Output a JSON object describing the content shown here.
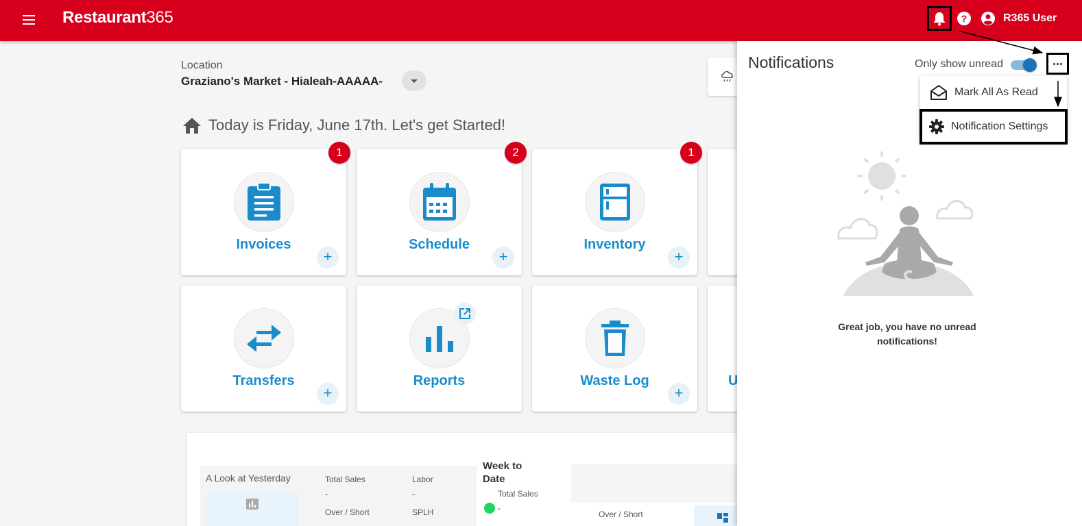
{
  "header": {
    "brand_text": "Restaurant",
    "brand_num": "365",
    "user_name": "R365 User",
    "brand_color": "#d6001c"
  },
  "location": {
    "label": "Location",
    "value": "Graziano's Market - Hialeah-AAAAA-"
  },
  "greeting": "Today is Friday, June 17th. Let's get Started!",
  "tiles": [
    {
      "name": "Invoices",
      "badge": "1",
      "plus": "+"
    },
    {
      "name": "Schedule",
      "badge": "2",
      "plus": "+"
    },
    {
      "name": "Inventory",
      "badge": "1",
      "plus": "+"
    },
    {
      "name": "Transfers",
      "plus": "+"
    },
    {
      "name": "Reports"
    },
    {
      "name": "Waste Log",
      "plus": "+"
    },
    {
      "name_partial": "U"
    }
  ],
  "dashboard": {
    "yesterday_title": "A Look at Yesterday",
    "total_sales_label": "Total Sales",
    "total_sales_value": "-",
    "labor_label": "Labor",
    "labor_value": "-",
    "over_short_label": "Over / Short",
    "splh_label": "SPLH",
    "week_to_date": "Week to Date",
    "wtd_total_sales_label": "Total Sales",
    "wtd_total_sales_value": "-",
    "wtd_over_short_label": "Over / Short"
  },
  "notifications": {
    "title": "Notifications",
    "only_unread_label": "Only show unread",
    "only_unread_on": true,
    "menu": [
      {
        "label": "Mark All As Read",
        "icon": "envelope-open-icon"
      },
      {
        "label": "Notification Settings",
        "icon": "gear-icon"
      }
    ],
    "empty_message": "Great job, you have no unread notifications!"
  }
}
